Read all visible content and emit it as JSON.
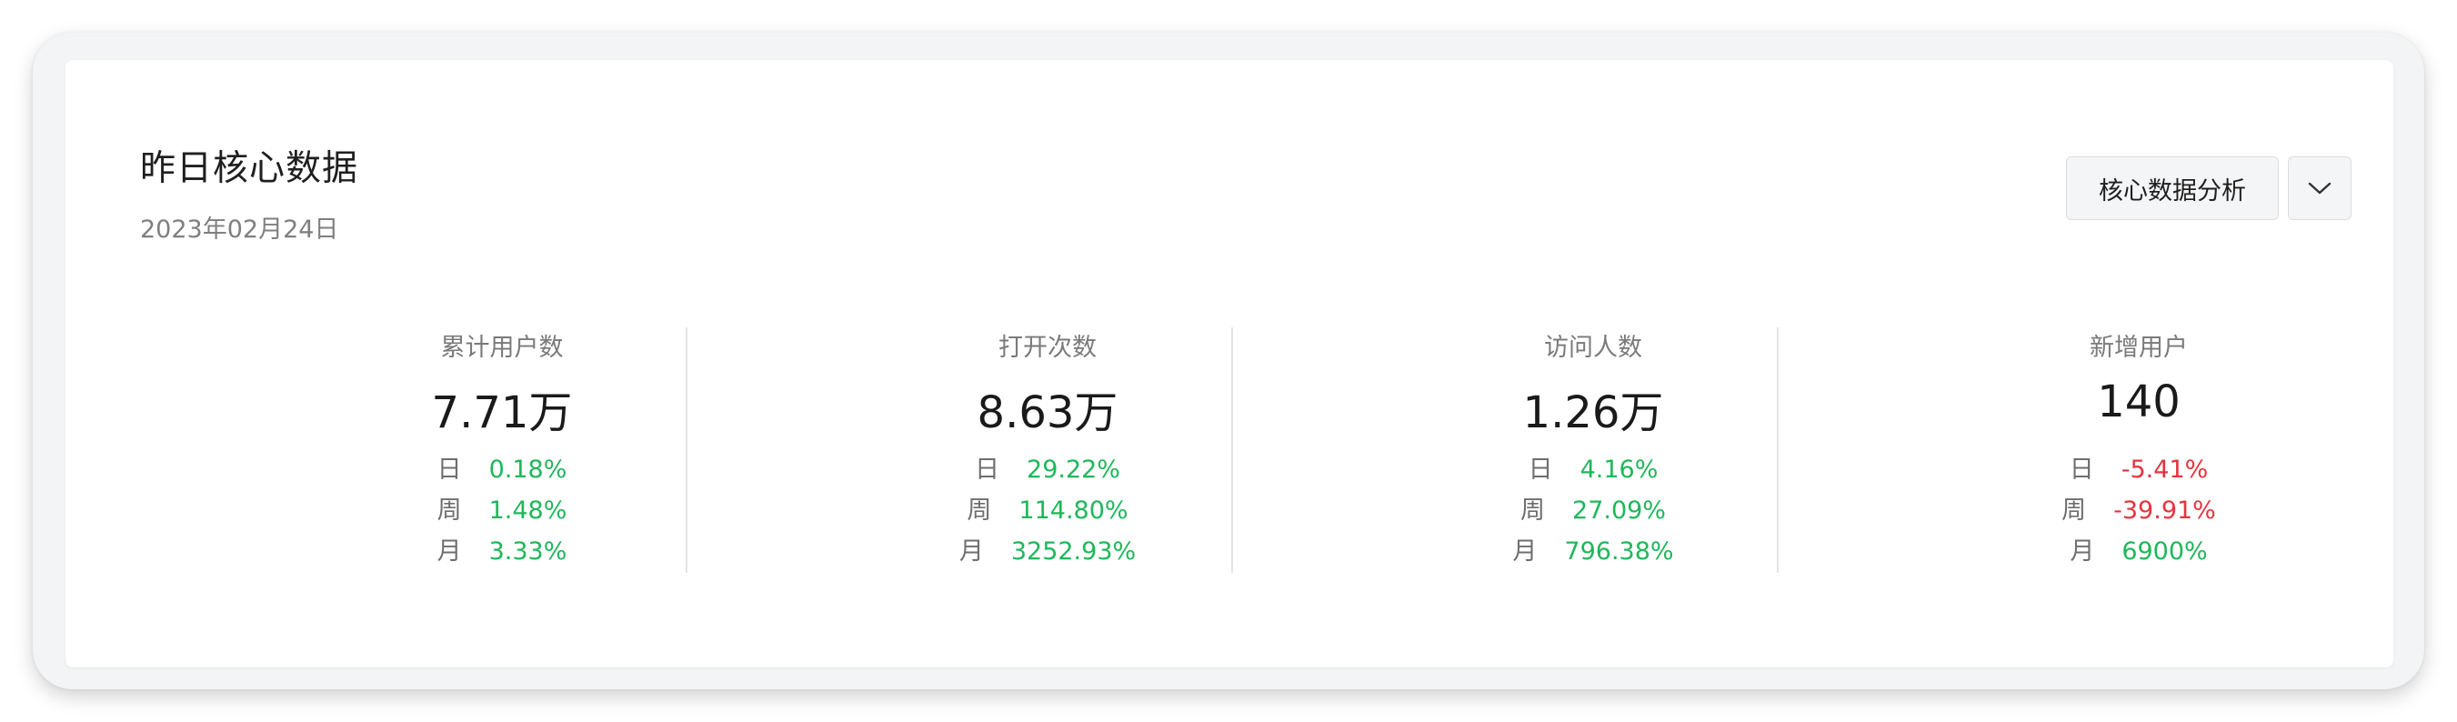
{
  "header": {
    "title": "昨日核心数据",
    "date": "2023年02月24日"
  },
  "actions": {
    "analysis_label": "核心数据分析",
    "dropdown_icon": "chevron-down-icon"
  },
  "colors": {
    "positive": "#1fb75a",
    "negative": "#e5343f"
  },
  "stats": [
    {
      "label": "累计用户数",
      "value": "7.71万",
      "changes": [
        {
          "period": "日",
          "value": "0.18%",
          "trend": "up"
        },
        {
          "period": "周",
          "value": "1.48%",
          "trend": "up"
        },
        {
          "period": "月",
          "value": "3.33%",
          "trend": "up"
        }
      ]
    },
    {
      "label": "打开次数",
      "value": "8.63万",
      "changes": [
        {
          "period": "日",
          "value": "29.22%",
          "trend": "up"
        },
        {
          "period": "周",
          "value": "114.80%",
          "trend": "up"
        },
        {
          "period": "月",
          "value": "3252.93%",
          "trend": "up"
        }
      ]
    },
    {
      "label": "访问人数",
      "value": "1.26万",
      "changes": [
        {
          "period": "日",
          "value": "4.16%",
          "trend": "up"
        },
        {
          "period": "周",
          "value": "27.09%",
          "trend": "up"
        },
        {
          "period": "月",
          "value": "796.38%",
          "trend": "up"
        }
      ]
    },
    {
      "label": "新增用户",
      "value": "140",
      "changes": [
        {
          "period": "日",
          "value": "-5.41%",
          "trend": "down"
        },
        {
          "period": "周",
          "value": "-39.91%",
          "trend": "down"
        },
        {
          "period": "月",
          "value": "6900%",
          "trend": "up"
        }
      ]
    }
  ]
}
